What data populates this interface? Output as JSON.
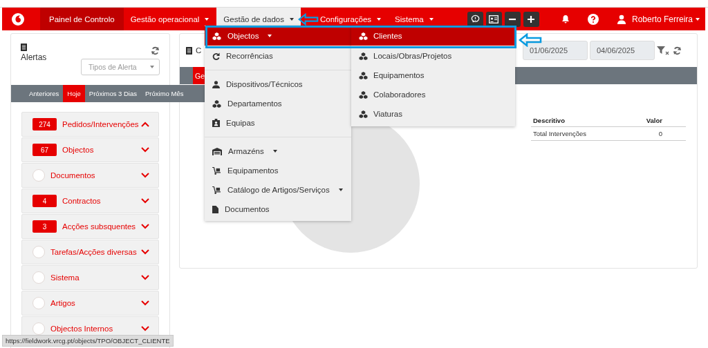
{
  "navbar": {
    "items": [
      {
        "label": "Painel de Controlo",
        "caret": false,
        "selected": false,
        "kind": "dark"
      },
      {
        "label": "Gestão operacional",
        "caret": true,
        "selected": false,
        "kind": "plain"
      },
      {
        "label": "Gestão de dados",
        "caret": true,
        "selected": true,
        "kind": "plain"
      },
      {
        "label": "Configurações",
        "caret": true,
        "selected": false,
        "kind": "plain"
      },
      {
        "label": "Sistema",
        "caret": true,
        "selected": false,
        "kind": "plain"
      }
    ],
    "user": "Roberto Ferreira"
  },
  "alerts": {
    "title": "Alertas",
    "filter_placeholder": "Tipos de Alerta",
    "tabs": [
      {
        "label": "Anteriores",
        "selected": false
      },
      {
        "label": "Hoje",
        "selected": true
      },
      {
        "label": "Próximos 3 Dias",
        "selected": false
      },
      {
        "label": "Próximo Mês",
        "selected": false
      }
    ],
    "groups": [
      {
        "count": "274",
        "label": "Pedidos/Intervenções",
        "expanded": true
      },
      {
        "count": "67",
        "label": "Objectos",
        "expanded": false
      },
      {
        "label": "Documentos",
        "expanded": false
      },
      {
        "count": "4",
        "label": "Contractos",
        "expanded": false
      },
      {
        "count": "3",
        "label": "Acções subsquentes",
        "expanded": false
      },
      {
        "label": "Tarefas/Acções diversas",
        "expanded": false
      },
      {
        "label": "Sistema",
        "expanded": false
      },
      {
        "label": "Artigos",
        "expanded": false
      },
      {
        "label": "Objectos Internos",
        "expanded": false
      }
    ]
  },
  "dashboard": {
    "title": "C",
    "date_from": "01/06/2025",
    "date_to": "04/06/2025",
    "tab": "Ge",
    "table": {
      "columns": [
        "Descritivo",
        "Valor"
      ],
      "rows": [
        [
          "Total Intervenções",
          "0"
        ]
      ]
    }
  },
  "menu": {
    "sections": [
      [
        {
          "label": "Objectos",
          "submenu": true,
          "selected": true
        },
        {
          "label": "Recorrências",
          "submenu": false,
          "selected": false
        }
      ],
      [
        {
          "label": "Dispositivos/Técnicos",
          "submenu": false,
          "selected": false
        },
        {
          "label": "Departamentos",
          "submenu": false,
          "selected": false
        },
        {
          "label": "Equipas",
          "submenu": false,
          "selected": false
        }
      ],
      [
        {
          "label": "Armazéns",
          "submenu": true,
          "selected": false
        },
        {
          "label": "Equipamentos",
          "submenu": false,
          "selected": false
        },
        {
          "label": "Catálogo de Artigos/Serviços",
          "submenu": true,
          "selected": false
        },
        {
          "label": "Documentos",
          "submenu": false,
          "selected": false
        }
      ]
    ],
    "submenu": [
      {
        "label": "Clientes",
        "selected": true
      },
      {
        "label": "Locais/Obras/Projetos",
        "selected": false
      },
      {
        "label": "Equipamentos",
        "selected": false
      },
      {
        "label": "Colaboradores",
        "selected": false
      },
      {
        "label": "Viaturas",
        "selected": false
      }
    ]
  },
  "status_url": "https://fieldwork.vrcg.pt/objects/TPO/OBJECT_CLIENTE"
}
